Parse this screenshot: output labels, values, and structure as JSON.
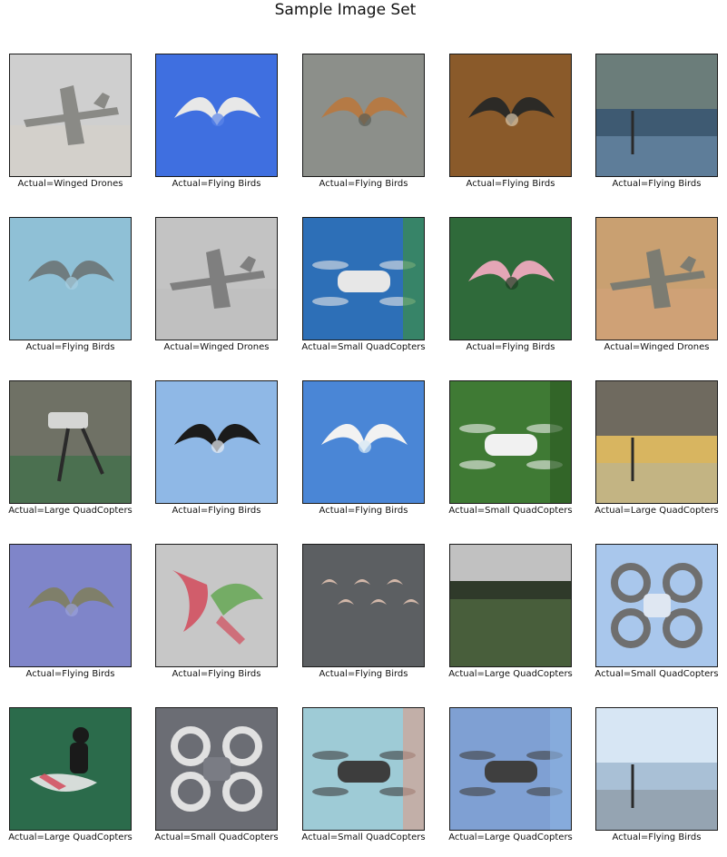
{
  "figure": {
    "title": "Sample Image Set"
  },
  "panels": [
    {
      "caption": "Actual=Winged Drones",
      "subject": "winged-drone",
      "colors": [
        "#cfcfcf",
        "#8a8a86",
        "#d7d2c9"
      ]
    },
    {
      "caption": "Actual=Flying Birds",
      "subject": "flying-bird",
      "colors": [
        "#3f6fe0",
        "#e8e8e8",
        "#5d86e8"
      ]
    },
    {
      "caption": "Actual=Flying Birds",
      "subject": "flying-bird",
      "colors": [
        "#8c8f8a",
        "#b57a45",
        "#5a5e57"
      ]
    },
    {
      "caption": "Actual=Flying Birds",
      "subject": "flying-bird",
      "colors": [
        "#8a5a2a",
        "#2c2a26",
        "#d8c7ad"
      ]
    },
    {
      "caption": "Actual=Flying Birds",
      "subject": "landscape",
      "colors": [
        "#3e5a72",
        "#9cc0e1",
        "#6b7d7a"
      ]
    },
    {
      "caption": "Actual=Flying Birds",
      "subject": "flying-bird",
      "colors": [
        "#8fc0d6",
        "#6f7c7f",
        "#a7cfe1"
      ]
    },
    {
      "caption": "Actual=Winged Drones",
      "subject": "winged-drone",
      "colors": [
        "#c3c3c3",
        "#7f7f7f",
        "#bdbdbd"
      ]
    },
    {
      "caption": "Actual=Small QuadCopters",
      "subject": "quadcopter",
      "colors": [
        "#2d6fb7",
        "#e7e7e7",
        "#3e8f3e"
      ]
    },
    {
      "caption": "Actual=Flying Birds",
      "subject": "flying-bird",
      "colors": [
        "#2f6a3a",
        "#e4a6b6",
        "#1d3d22"
      ]
    },
    {
      "caption": "Actual=Winged Drones",
      "subject": "winged-drone",
      "colors": [
        "#c9a071",
        "#7c7c72",
        "#d4a27a"
      ]
    },
    {
      "caption": "Actual=Large QuadCopters",
      "subject": "large-quadcopter",
      "colors": [
        "#6f7165",
        "#e7e7e7",
        "#2e6f3f"
      ]
    },
    {
      "caption": "Actual=Flying Birds",
      "subject": "flying-bird",
      "colors": [
        "#8fb8e6",
        "#1b1b1b",
        "#e9eef4"
      ]
    },
    {
      "caption": "Actual=Flying Birds",
      "subject": "flying-bird",
      "colors": [
        "#4a86d6",
        "#f2f2f2",
        "#d6e8f5"
      ]
    },
    {
      "caption": "Actual=Small QuadCopters",
      "subject": "quadcopter",
      "colors": [
        "#3f7a34",
        "#f1f1f1",
        "#2b5a22"
      ]
    },
    {
      "caption": "Actual=Large QuadCopters",
      "subject": "landscape",
      "colors": [
        "#d8b560",
        "#9fb3c6",
        "#6f6a5f"
      ]
    },
    {
      "caption": "Actual=Flying Birds",
      "subject": "flying-bird",
      "colors": [
        "#7f85c9",
        "#7f7f6a",
        "#9aa1da"
      ]
    },
    {
      "caption": "Actual=Flying Birds",
      "subject": "hummingbird",
      "colors": [
        "#c7c7c7",
        "#d24a5a",
        "#6aa85a"
      ]
    },
    {
      "caption": "Actual=Flying Birds",
      "subject": "flock",
      "colors": [
        "#5c5f62",
        "#e0c2b1",
        "#6b6f73"
      ]
    },
    {
      "caption": "Actual=Large QuadCopters",
      "subject": "field",
      "colors": [
        "#c1c1c1",
        "#2f3a2a",
        "#79a45c"
      ]
    },
    {
      "caption": "Actual=Small QuadCopters",
      "subject": "quadcopter-top",
      "colors": [
        "#a9c7ec",
        "#6f6f6f",
        "#dfe7f2"
      ]
    },
    {
      "caption": "Actual=Large QuadCopters",
      "subject": "person-drone",
      "colors": [
        "#2b6b4b",
        "#e9e9e9",
        "#d24a5a"
      ]
    },
    {
      "caption": "Actual=Small QuadCopters",
      "subject": "quadcopter-top",
      "colors": [
        "#6b6d74",
        "#e1e1e1",
        "#7a7c84"
      ]
    },
    {
      "caption": "Actual=Small QuadCopters",
      "subject": "quadcopter",
      "colors": [
        "#9ecbd6",
        "#3d3d3d",
        "#d6a08f"
      ]
    },
    {
      "caption": "Actual=Large QuadCopters",
      "subject": "quadcopter",
      "colors": [
        "#7fa0d3",
        "#3f3f3f",
        "#8bb0e0"
      ]
    },
    {
      "caption": "Actual=Flying Birds",
      "subject": "landscape",
      "colors": [
        "#a9c0d6",
        "#6f6f6f",
        "#d7e6f4"
      ]
    }
  ]
}
